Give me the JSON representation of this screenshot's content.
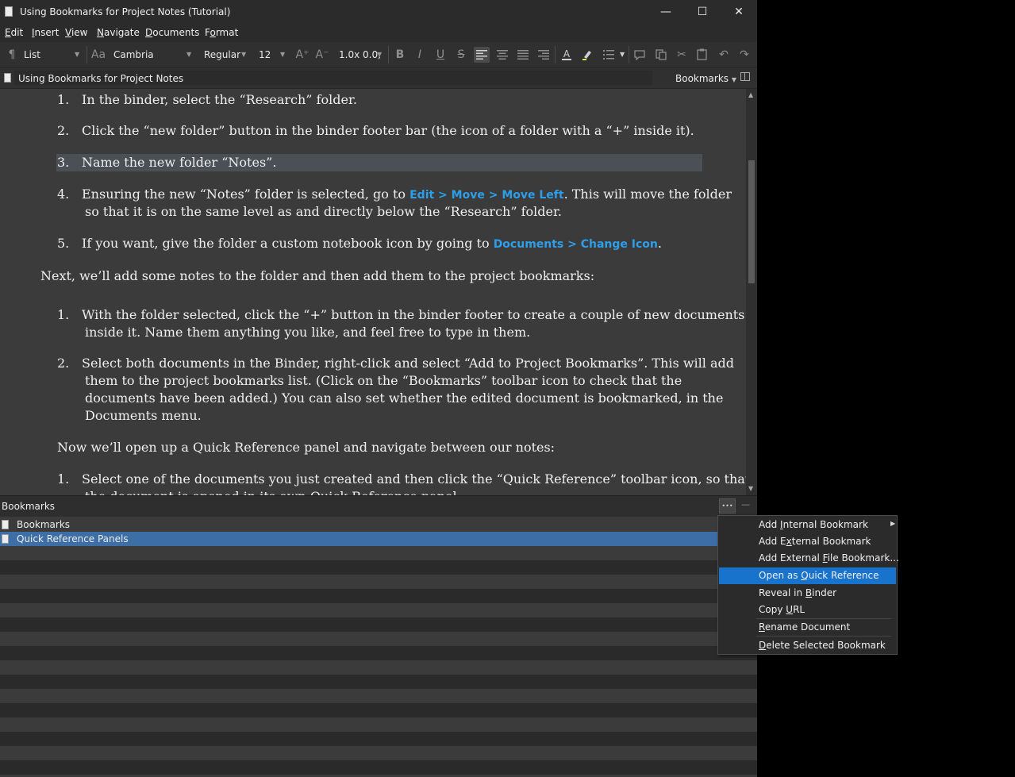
{
  "window": {
    "title": "Using Bookmarks for Project Notes (Tutorial)",
    "controls": {
      "minimize": "—",
      "maximize": "☐",
      "close": "✕"
    }
  },
  "menubar": {
    "items": [
      {
        "pre": "",
        "key": "E",
        "post": "dit"
      },
      {
        "pre": "",
        "key": "I",
        "post": "nsert"
      },
      {
        "pre": "",
        "key": "V",
        "post": "iew"
      },
      {
        "pre": "",
        "key": "N",
        "post": "avigate"
      },
      {
        "pre": "",
        "key": "D",
        "post": "ocuments"
      },
      {
        "pre": "F",
        "key": "o",
        "post": "rmat"
      }
    ]
  },
  "toolbar": {
    "paragraph_style": "List",
    "font_family": "Cambria",
    "font_style": "Regular",
    "font_size": "12",
    "line_spacing": "1.0x 0.0,",
    "icons": {
      "pilcrow": "¶",
      "font_panel": "Aa",
      "increase_font": "A⁺",
      "decrease_font": "A⁻",
      "bold": "B",
      "italic": "I",
      "underline": "U",
      "strikethrough": "S"
    }
  },
  "header": {
    "document_title": "Using Bookmarks for Project Notes",
    "bookmarks_menu": "Bookmarks"
  },
  "editor": {
    "list1": [
      {
        "num": "1.",
        "text": "In the binder, select the “Research” folder."
      },
      {
        "num": "2.",
        "text": "Click the “new folder” button in the binder footer bar (the icon of a folder with a “+” inside it)."
      },
      {
        "num": "3.",
        "text": "Name the new folder “Notes”."
      },
      {
        "num": "4.",
        "text_a": "Ensuring the new “Notes” folder is selected, go to ",
        "link": "Edit > Move > Move Left",
        "text_b": ". This will move the folder",
        "text_c": "so that it is on the same level as and directly below the “Research” folder."
      },
      {
        "num": "5.",
        "text_a": "If you want, give the folder a custom notebook icon by going to ",
        "link": "Documents > Change Icon",
        "text_b": "."
      }
    ],
    "para1": "Next, we’ll add some notes to the folder and then add them to the project bookmarks:",
    "list2": [
      {
        "num": "1.",
        "line1": "With the folder selected, click the “+” button in the binder footer to create a couple of new documents",
        "line2": "inside it. Name them anything you like, and feel free to type in them."
      },
      {
        "num": "2.",
        "line1": "Select both documents in the Binder, right-click and select “Add to Project Bookmarks”. This will add",
        "line2": "them to the project bookmarks list. (Click on the “Bookmarks” toolbar icon to check that the",
        "line3": "documents have been added.) You can also set whether the edited document is bookmarked, in the",
        "line4": "Documents menu."
      }
    ],
    "para2": "Now we’ll open up a Quick Reference panel and navigate between our notes:",
    "list3": [
      {
        "num": "1.",
        "line1": "Select one of the documents you just created and then click the “Quick Reference” toolbar icon, so that",
        "line2": "the document is opened in its own Quick Reference panel."
      }
    ]
  },
  "bookmarks_panel": {
    "title": "Bookmarks",
    "options_icon": "•••",
    "collapse_icon": "—",
    "items": [
      {
        "label": "Bookmarks",
        "selected": false
      },
      {
        "label": "Quick Reference Panels",
        "selected": true
      }
    ]
  },
  "context_menu": {
    "items": [
      {
        "pre": "Add ",
        "key": "I",
        "post": "nternal Bookmark",
        "submenu": true,
        "highlighted": false
      },
      {
        "pre": "Add E",
        "key": "x",
        "post": "ternal Bookmark",
        "submenu": false,
        "highlighted": false
      },
      {
        "pre": "Add External ",
        "key": "F",
        "post": "ile Bookmark...",
        "submenu": false,
        "highlighted": false
      },
      {
        "pre": "Open as ",
        "key": "Q",
        "post": "uick Reference",
        "submenu": false,
        "highlighted": true
      },
      {
        "pre": "Reveal in ",
        "key": "B",
        "post": "inder",
        "submenu": false,
        "highlighted": false
      },
      {
        "pre": "Copy ",
        "key": "U",
        "post": "RL",
        "submenu": false,
        "highlighted": false
      },
      {
        "pre": "",
        "key": "R",
        "post": "ename Document",
        "submenu": false,
        "highlighted": false
      },
      {
        "pre": "",
        "key": "D",
        "post": "elete Selected Bookmark",
        "submenu": false,
        "highlighted": false
      }
    ]
  },
  "colors": {
    "selection": "#3e6ea6",
    "menu_highlight": "#1873cc",
    "link": "#2e9ee8"
  }
}
